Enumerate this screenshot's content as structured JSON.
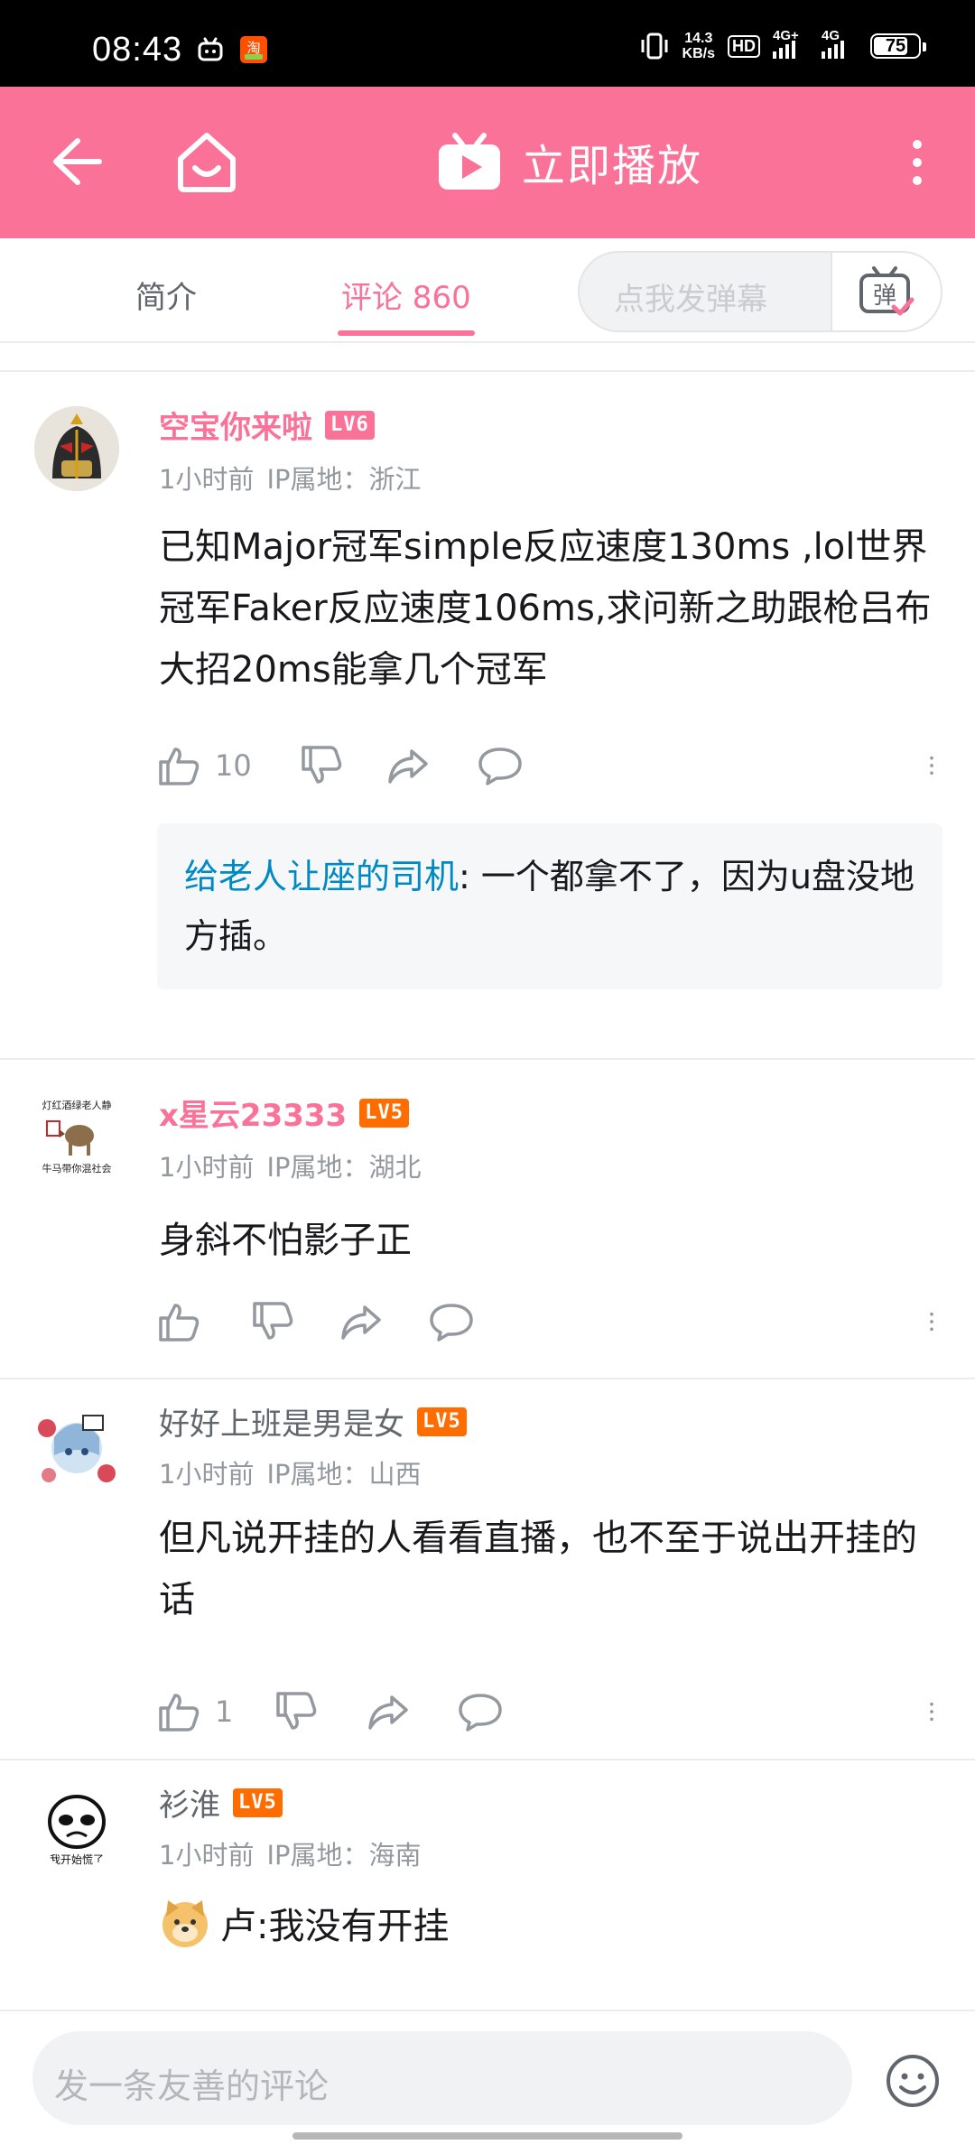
{
  "status_bar": {
    "time": "08:43",
    "net_speed_value": "14.3",
    "net_speed_unit": "KB/s",
    "hd": "HD",
    "sim_1": "4G+",
    "sim_2": "4G",
    "battery": "75"
  },
  "header": {
    "play_label": "立即播放",
    "background_color": "#fb7299"
  },
  "tabs": {
    "intro": "简介",
    "comments": "评论 860",
    "danmaku_placeholder": "点我发弹幕",
    "danmaku_button": "弹"
  },
  "comments": [
    {
      "username": "空宝你来啦",
      "level": "LV6",
      "time": "1小时前",
      "ip": "IP属地：浙江",
      "text": "已知Major冠军simple反应速度130ms ,lol世界冠军Faker反应速度106ms,求问新之助跟枪吕布大招20ms能拿几个冠军",
      "likes": "10",
      "reply": {
        "user": "给老人让座的司机",
        "text": ": 一个都拿不了，因为u盘没地方插。"
      }
    },
    {
      "username": "x星云23333",
      "level": "LV5",
      "time": "1小时前",
      "ip": "IP属地：湖北",
      "text": "身斜不怕影子正",
      "likes": "",
      "avatar_text_top": "灯红酒绿老人静",
      "avatar_text_bottom": "牛马带你混社会"
    },
    {
      "username": "好好上班是男是女",
      "level": "LV5",
      "time": "1小时前",
      "ip": "IP属地：山西",
      "text": "但凡说开挂的人看看直播，也不至于说出开挂的话",
      "likes": "1"
    },
    {
      "username": "衫淮",
      "level": "LV5",
      "time": "1小时前",
      "ip": "IP属地：海南",
      "text": "卢:我没有开挂",
      "avatar_text": "我开始慌了"
    }
  ],
  "bottom": {
    "input_placeholder": "发一条友善的评论"
  }
}
